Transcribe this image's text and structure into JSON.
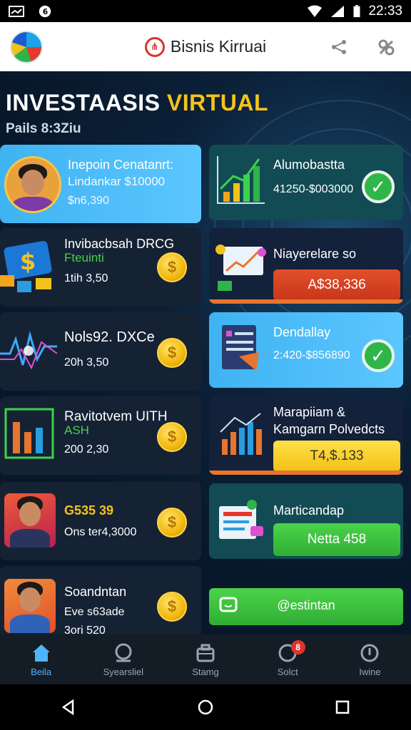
{
  "status_bar": {
    "time": "22:33"
  },
  "app_header": {
    "title": "Bisnis Kirruai",
    "logo_icon": "brand-logo-icon",
    "left_icon": "globe-icon",
    "right_icons": [
      "share-icon",
      "link-icon"
    ]
  },
  "hero": {
    "title_white": "INVESTAASIS",
    "title_accent": "VIRTUAL",
    "subtitle": "Pails 8:3Ziu",
    "accent_color": "#f6c21c"
  },
  "left_cards": [
    {
      "line1": "Inepoin Cenatanrt:",
      "line2": "Lindankar $10000",
      "line3": "$n6,390"
    },
    {
      "line1": "Invibacbsah DRCG",
      "line2": "Fteuinti",
      "line3": "1tih 3,50"
    },
    {
      "line1": "Nols92. DXCe",
      "line2": "",
      "line3": "20h 3,50"
    },
    {
      "line1": "Ravitotvem UITH",
      "line2": "ASH",
      "line3": "200 2,30"
    },
    {
      "line1": "G535 39",
      "line2": "",
      "line3": "Ons ter4,3000"
    },
    {
      "line1": "Soandntan",
      "line2": "Eve s63ade",
      "line3": "3ori 520"
    }
  ],
  "right_cards": [
    {
      "title": "Alumobastta",
      "value": "41250-$003000"
    },
    {
      "title": "Niayerelare so",
      "button": "A$38,336"
    },
    {
      "title": "Dendallay",
      "value": "2:420-$856890"
    },
    {
      "title": "Marapiiam &",
      "title2": "Kamgarn Polvedcts",
      "button": "T4,$.133"
    },
    {
      "title": "Marticandap",
      "button": "Netta 458"
    },
    {
      "button": "@estintan"
    }
  ],
  "bottom_nav": [
    {
      "label": "Beila",
      "icon": "home-icon"
    },
    {
      "label": "Syearsliel",
      "icon": "search-icon"
    },
    {
      "label": "Stamg",
      "icon": "briefcase-icon"
    },
    {
      "label": "Solct",
      "icon": "notification-icon",
      "badge": "8"
    },
    {
      "label": "Iwine",
      "icon": "info-icon"
    }
  ],
  "colors": {
    "red_button": "#d93a1f",
    "yellow_button": "#f7cf16",
    "green_button": "#3cc23e",
    "active_nav": "#4fb4ff"
  }
}
